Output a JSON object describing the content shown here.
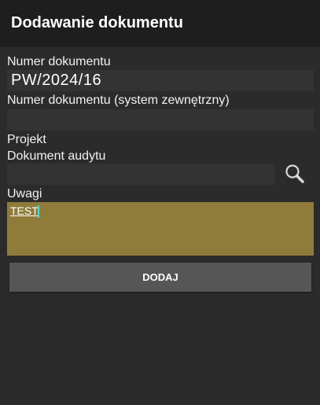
{
  "header": {
    "title": "Dodawanie dokumentu"
  },
  "form": {
    "document_number": {
      "label": "Numer dokumentu",
      "value": "PW/2024/16"
    },
    "external_document_number": {
      "label": "Numer dokumentu (system zewnętrzny)",
      "value": ""
    },
    "project": {
      "label": "Projekt"
    },
    "audit_document": {
      "label": "Dokument audytu",
      "value": "",
      "icon": "search-icon"
    },
    "notes": {
      "label": "Uwagi",
      "value": "TEST"
    },
    "add_button_label": "DODAJ"
  },
  "colors": {
    "background": "#2b2b2b",
    "title_bar": "#1e1e1e",
    "field_background": "#333333",
    "notes_background": "#8f7b3a",
    "button_background": "#565656",
    "caret": "#5fd6d0"
  }
}
